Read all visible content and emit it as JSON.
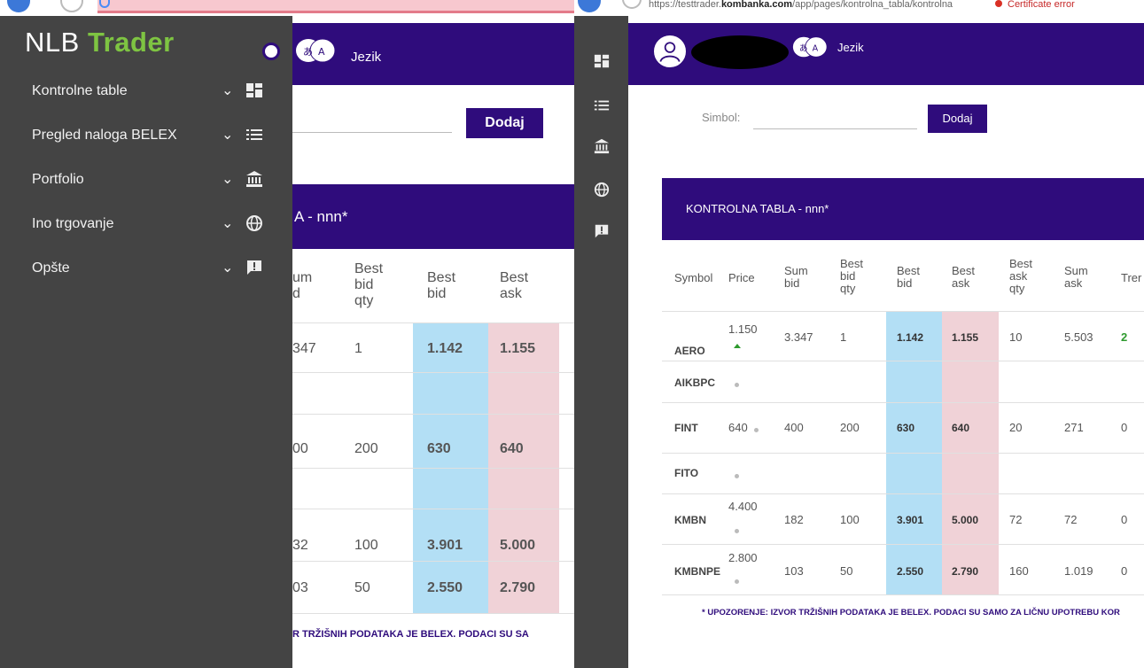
{
  "browser_right": {
    "url_prefix": "https://testtrader.",
    "url_domain": "kombanka.com",
    "url_suffix": "/app/pages/kontrolna_tabla/kontrolna",
    "cert_text": "Certificate error"
  },
  "left_window": {
    "logo": {
      "nlb": "NLB",
      "trader": "Trader"
    },
    "header": {
      "language_label": "Jezik"
    },
    "add_button": "Dodaj",
    "table_title": "A - nnn*",
    "headers": {
      "sum_bid": "um\nd",
      "best_bid_qty": "Best\nbid\nqty",
      "best_bid": "Best\nbid",
      "best_ask": "Best\nask"
    },
    "rows": [
      {
        "sum_bid": "347",
        "qty": "1",
        "bid": "1.142",
        "ask": "1.155"
      },
      {
        "sum_bid": "",
        "qty": "",
        "bid": "",
        "ask": ""
      },
      {
        "sum_bid": "00",
        "qty": "200",
        "bid": "630",
        "ask": "640"
      },
      {
        "sum_bid": "",
        "qty": "",
        "bid": "",
        "ask": ""
      },
      {
        "sum_bid": "32",
        "qty": "100",
        "bid": "3.901",
        "ask": "5.000"
      },
      {
        "sum_bid": "03",
        "qty": "50",
        "bid": "2.550",
        "ask": "2.790"
      }
    ],
    "warning": "R TRŽIŠNIH PODATAKA JE BELEX. PODACI SU SA"
  },
  "sidebar": {
    "items": [
      {
        "label": "Kontrolne table",
        "icon": "dashboard-icon"
      },
      {
        "label": "Pregled naloga BELEX",
        "icon": "list-icon"
      },
      {
        "label": "Portfolio",
        "icon": "bank-icon"
      },
      {
        "label": "Ino trgovanje",
        "icon": "globe-icon"
      },
      {
        "label": "Opšte",
        "icon": "feedback-icon"
      }
    ]
  },
  "right_window": {
    "header": {
      "language_label": "Jezik"
    },
    "symbol_label": "Simbol:",
    "symbol_value": "",
    "add_button": "Dodaj",
    "table_title": "KONTROLNA TABLA - nnn*",
    "headers": {
      "symbol": "Symbol",
      "price": "Price",
      "sum_bid": "Sum\nbid",
      "best_bid_qty": "Best\nbid\nqty",
      "best_bid": "Best\nbid",
      "best_ask": "Best\nask",
      "best_ask_qty": "Best\nask\nqty",
      "sum_ask": "Sum\nask",
      "trend": "Trer"
    },
    "rows": [
      {
        "symbol": "AERO",
        "price": "1.150",
        "sum_bid": "3.347",
        "qty": "1",
        "bid": "1.142",
        "ask": "1.155",
        "ask_qty": "10",
        "sum_ask": "5.503",
        "trend": "2"
      },
      {
        "symbol": "AIKBPC",
        "price": "",
        "sum_bid": "",
        "qty": "",
        "bid": "",
        "ask": "",
        "ask_qty": "",
        "sum_ask": "",
        "trend": ""
      },
      {
        "symbol": "FINT",
        "price": "640",
        "sum_bid": "400",
        "qty": "200",
        "bid": "630",
        "ask": "640",
        "ask_qty": "20",
        "sum_ask": "271",
        "trend": "0"
      },
      {
        "symbol": "FITO",
        "price": "",
        "sum_bid": "",
        "qty": "",
        "bid": "",
        "ask": "",
        "ask_qty": "",
        "sum_ask": "",
        "trend": ""
      },
      {
        "symbol": "KMBN",
        "price": "4.400",
        "sum_bid": "182",
        "qty": "100",
        "bid": "3.901",
        "ask": "5.000",
        "ask_qty": "72",
        "sum_ask": "72",
        "trend": "0"
      },
      {
        "symbol": "KMBNPE",
        "price": "2.800",
        "sum_bid": "103",
        "qty": "50",
        "bid": "2.550",
        "ask": "2.790",
        "ask_qty": "160",
        "sum_ask": "1.019",
        "trend": "0"
      }
    ],
    "warning": "* UPOZORENJE: IZVOR TRŽIŠNIH PODATAKA JE BELEX. PODACI SU SAMO ZA LIČNU UPOTREBU KOR"
  },
  "colors": {
    "brand_purple": "#2f0c7c",
    "sidebar_gray": "#444444",
    "logo_green": "#7ec442",
    "bid_blue": "#b3dff5",
    "ask_pink": "#f0d2d7",
    "up_green": "#2e9a2e"
  }
}
